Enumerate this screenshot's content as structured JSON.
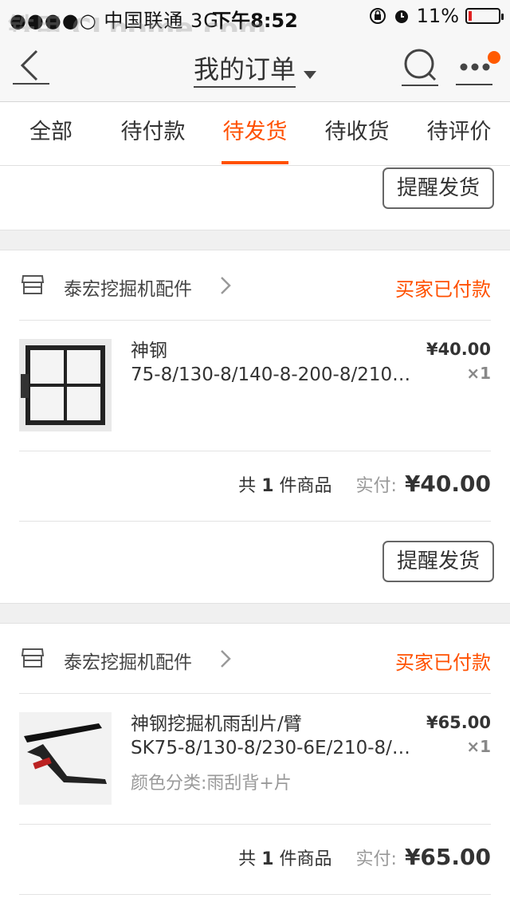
{
  "status_bar": {
    "carrier": "●●●●○ 中国联通 3G",
    "time": "下午8:52",
    "battery": "11%",
    "battery_level": 0.11,
    "watermark": "铁甲 CLnome.com"
  },
  "nav": {
    "title": "我的订单",
    "back_icon": "chevron-left-icon",
    "search_icon": "search-icon",
    "more_icon": "more-icon",
    "badge_color": "#ff5a00"
  },
  "tabs": [
    {
      "label": "全部",
      "active": false
    },
    {
      "label": "待付款",
      "active": false
    },
    {
      "label": "待发货",
      "active": true
    },
    {
      "label": "待收货",
      "active": false
    },
    {
      "label": "待评价",
      "active": false
    }
  ],
  "accent_color": "#ff5000",
  "top_action": {
    "label": "提醒发货"
  },
  "orders": [
    {
      "shop": "泰宏挖掘机配件",
      "status": "买家已付款",
      "item": {
        "title1": "神钢",
        "title2": "75-8/130-8/140-8-200-8/210…",
        "sku": "",
        "price": "¥40.00",
        "qty": "×1"
      },
      "summary": {
        "count_prefix": "共",
        "count": "1",
        "count_suffix": "件商品",
        "paid_label": "实付:",
        "amount": "¥40.00"
      },
      "action": "提醒发货"
    },
    {
      "shop": "泰宏挖掘机配件",
      "status": "买家已付款",
      "item": {
        "title1": "神钢挖掘机雨刮片/臂",
        "title2": "SK75-8/130-8/230-6E/210-8/…",
        "sku": "颜色分类:雨刮背+片",
        "price": "¥65.00",
        "qty": "×1"
      },
      "summary": {
        "count_prefix": "共",
        "count": "1",
        "count_suffix": "件商品",
        "paid_label": "实付:",
        "amount": "¥65.00"
      }
    }
  ]
}
